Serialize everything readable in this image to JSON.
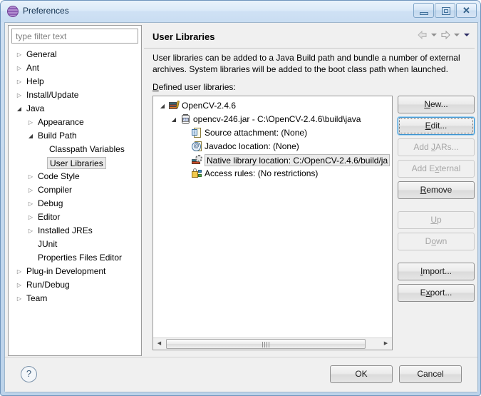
{
  "window": {
    "title": "Preferences",
    "icon": "preferences-globe-icon",
    "minimize_label": "",
    "restore_label": "",
    "close_label": "✕"
  },
  "sidebar": {
    "filter": {
      "placeholder": "type filter text",
      "value": ""
    },
    "items": [
      {
        "label": "General",
        "indent": 0,
        "state": "collapsed",
        "selected": false
      },
      {
        "label": "Ant",
        "indent": 0,
        "state": "collapsed",
        "selected": false
      },
      {
        "label": "Help",
        "indent": 0,
        "state": "collapsed",
        "selected": false
      },
      {
        "label": "Install/Update",
        "indent": 0,
        "state": "collapsed",
        "selected": false
      },
      {
        "label": "Java",
        "indent": 0,
        "state": "expanded",
        "selected": false
      },
      {
        "label": "Appearance",
        "indent": 1,
        "state": "collapsed",
        "selected": false
      },
      {
        "label": "Build Path",
        "indent": 1,
        "state": "expanded",
        "selected": false
      },
      {
        "label": "Classpath Variables",
        "indent": 2,
        "state": "leaf",
        "selected": false
      },
      {
        "label": "User Libraries",
        "indent": 2,
        "state": "leaf",
        "selected": true
      },
      {
        "label": "Code Style",
        "indent": 1,
        "state": "collapsed",
        "selected": false
      },
      {
        "label": "Compiler",
        "indent": 1,
        "state": "collapsed",
        "selected": false
      },
      {
        "label": "Debug",
        "indent": 1,
        "state": "collapsed",
        "selected": false
      },
      {
        "label": "Editor",
        "indent": 1,
        "state": "collapsed",
        "selected": false
      },
      {
        "label": "Installed JREs",
        "indent": 1,
        "state": "collapsed",
        "selected": false
      },
      {
        "label": "JUnit",
        "indent": 1,
        "state": "leaf",
        "selected": false
      },
      {
        "label": "Properties Files Editor",
        "indent": 1,
        "state": "leaf",
        "selected": false
      },
      {
        "label": "Plug-in Development",
        "indent": 0,
        "state": "collapsed",
        "selected": false
      },
      {
        "label": "Run/Debug",
        "indent": 0,
        "state": "collapsed",
        "selected": false
      },
      {
        "label": "Team",
        "indent": 0,
        "state": "collapsed",
        "selected": false
      }
    ]
  },
  "page": {
    "title": "User Libraries",
    "description": "User libraries can be added to a Java Build path and bundle a number of external archives. System libraries will be added to the boot class path when launched.",
    "defined_label_mnemonic": "D",
    "defined_label_rest": "efined user libraries:",
    "nav": {
      "back": "back-arrow",
      "back_menu": "back-dropdown",
      "forward": "forward-arrow",
      "forward_menu": "forward-dropdown",
      "view_menu": "view-menu-caret"
    }
  },
  "library_tree": [
    {
      "label": "OpenCV-2.4.6",
      "indent": 0,
      "state": "expanded",
      "icon": "library-books-icon",
      "selected": false
    },
    {
      "label": "opencv-246.jar - C:\\OpenCV-2.4.6\\build\\java",
      "indent": 1,
      "state": "expanded",
      "icon": "jar-icon",
      "selected": false
    },
    {
      "label": "Source attachment: (None)",
      "indent": 2,
      "state": "leaf",
      "icon": "source-attachment-icon",
      "selected": false
    },
    {
      "label": "Javadoc location: (None)",
      "indent": 2,
      "state": "leaf",
      "icon": "javadoc-icon",
      "selected": false
    },
    {
      "label": "Native library location: C:/OpenCV-2.4.6/build/ja",
      "indent": 2,
      "state": "leaf",
      "icon": "native-library-icon",
      "selected": true
    },
    {
      "label": "Access rules: (No restrictions)",
      "indent": 2,
      "state": "leaf",
      "icon": "access-rules-icon",
      "selected": false
    }
  ],
  "scrollbar": {
    "left_arrow": "◀",
    "right_arrow": "▶"
  },
  "buttons": [
    {
      "name": "new",
      "pre": "",
      "mn": "N",
      "post": "ew...",
      "state": "enabled",
      "gap_after": false
    },
    {
      "name": "edit",
      "pre": "",
      "mn": "E",
      "post": "dit...",
      "state": "focused",
      "gap_after": false
    },
    {
      "name": "add-jars",
      "pre": "Add ",
      "mn": "J",
      "post": "ARs...",
      "state": "disabled",
      "gap_after": false
    },
    {
      "name": "add-external-jars",
      "pre": "Add E",
      "mn": "x",
      "post": "ternal JARs...",
      "state": "disabled",
      "gap_after": false
    },
    {
      "name": "remove",
      "pre": "",
      "mn": "R",
      "post": "emove",
      "state": "enabled",
      "gap_after": true
    },
    {
      "name": "up",
      "pre": "",
      "mn": "U",
      "post": "p",
      "state": "disabled",
      "gap_after": false
    },
    {
      "name": "down",
      "pre": "D",
      "mn": "o",
      "post": "wn",
      "state": "disabled",
      "gap_after": true
    },
    {
      "name": "import",
      "pre": "",
      "mn": "I",
      "post": "mport...",
      "state": "enabled",
      "gap_after": false
    },
    {
      "name": "export",
      "pre": "E",
      "mn": "x",
      "post": "port...",
      "state": "enabled",
      "gap_after": false
    }
  ],
  "footer": {
    "help": "?",
    "ok": "OK",
    "cancel": "Cancel"
  },
  "colors": {
    "titlebar": "#cfe1f4",
    "window_border": "#6f95bd",
    "dialog_bg": "#f0f0f0",
    "focus_border": "#3c93d0",
    "selection_bg": "#eaeaea",
    "disabled_text": "#a6a6a6"
  }
}
